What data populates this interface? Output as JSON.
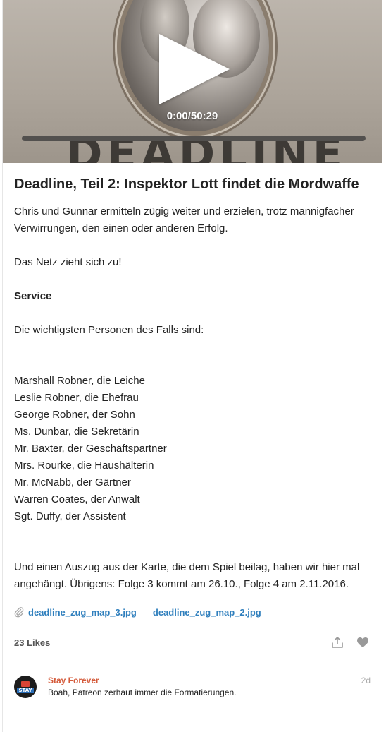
{
  "player": {
    "time_display": "0:00/50:29",
    "progress": 0.0,
    "cover_art_text": "DEADLINE"
  },
  "post": {
    "title": "Deadline, Teil 2: Inspektor Lott findet die Mordwaffe",
    "intro": "Chris und Gunnar ermitteln zügig weiter und erzielen, trotz mannigfacher Verwirrungen, den einen oder anderen Erfolg.",
    "teaser": "Das Netz zieht sich zu!",
    "service_heading": "Service",
    "persons_intro": "Die wichtigsten Personen des Falls sind:",
    "persons": [
      "Marshall Robner, die Leiche",
      "Leslie Robner, die Ehefrau",
      "George Robner, der Sohn",
      "Ms. Dunbar, die Sekretärin",
      "Mr. Baxter, der Geschäftspartner",
      "Mrs. Rourke, die Haushälterin",
      "Mr. McNabb, der Gärtner",
      "Warren Coates, der Anwalt",
      "Sgt. Duffy, der Assistent"
    ],
    "closing": "Und einen Auszug aus der Karte, die dem Spiel beilag, haben wir hier mal angehängt. Übrigens: Folge 3 kommt am 26.10., Folge 4 am 2.11.2016."
  },
  "attachments": [
    {
      "label": "deadline_zug_map_3.jpg"
    },
    {
      "label": "deadline_zug_map_2.jpg"
    }
  ],
  "stats": {
    "likes_label": "23 Likes"
  },
  "icons": {
    "attachment": "paperclip-icon",
    "share": "share-icon",
    "like": "heart-icon",
    "play": "play-icon"
  },
  "comment": {
    "author": "Stay Forever",
    "avatar_text": "STAY",
    "text": "Boah, Patreon zerhaut immer die Formatierungen.",
    "time": "2d"
  },
  "colors": {
    "link": "#2f7fbd",
    "author": "#d45a3a"
  }
}
